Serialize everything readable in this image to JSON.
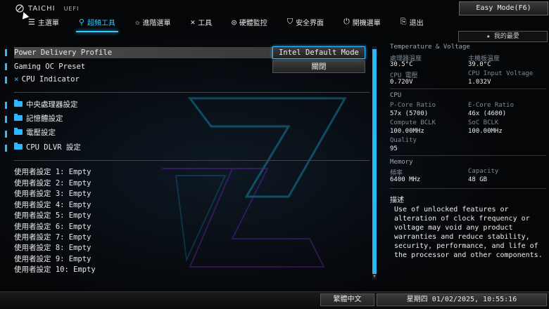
{
  "brand": {
    "name": "TAICHI",
    "sub": "UEFI"
  },
  "easy_mode_label": "Easy Mode(F6)",
  "tabs": [
    {
      "label": "主選單",
      "icon": "list-icon"
    },
    {
      "label": "超頻工具",
      "icon": "rocket-icon"
    },
    {
      "label": "進階選單",
      "icon": "star-icon"
    },
    {
      "label": "工具",
      "icon": "tools-icon"
    },
    {
      "label": "硬體監控",
      "icon": "monitor-icon"
    },
    {
      "label": "安全界面",
      "icon": "shield-icon"
    },
    {
      "label": "開機選單",
      "icon": "power-icon"
    },
    {
      "label": "退出",
      "icon": "exit-icon"
    }
  ],
  "favorites_label": "我的最愛",
  "settings": [
    {
      "label": "Power Delivery Profile",
      "value": "Intel Default Mode"
    },
    {
      "label": "Gaming OC Preset",
      "value": "關閉"
    },
    {
      "label": "CPU Indicator"
    }
  ],
  "folders": [
    "中央處理器設定",
    "記憶體設定",
    "電壓設定",
    "CPU DLVR 設定"
  ],
  "profiles": [
    "使用者設定 1: Empty",
    "使用者設定 2: Empty",
    "使用者設定 3: Empty",
    "使用者設定 4: Empty",
    "使用者設定 5: Empty",
    "使用者設定 6: Empty",
    "使用者設定 7: Empty",
    "使用者設定 8: Empty",
    "使用者設定 9: Empty",
    "使用者設定 10: Empty"
  ],
  "info": {
    "tv_title": "Temperature & Voltage",
    "cpu_temp_label": "處理器溫度",
    "cpu_temp": "30.5°C",
    "mb_temp_label": "主機板溫度",
    "mb_temp": "39.0°C",
    "cpu_volt_label": "CPU 電壓",
    "cpu_volt": "0.720V",
    "cpu_input_label": "CPU Input Voltage",
    "cpu_input": "1.032V",
    "cpu_title": "CPU",
    "pcore_label": "P-Core Ratio",
    "pcore": "57x (5700)",
    "ecore_label": "E-Core Ratio",
    "ecore": "46x (4600)",
    "compute_label": "Compute BCLK",
    "compute": "100.00MHz",
    "soc_label": "SoC BCLK",
    "soc": "100.00MHz",
    "quality_label": "Quality",
    "quality": "95",
    "mem_title": "Memory",
    "freq_label": "頻率",
    "freq": "6400 MHz",
    "cap_label": "Capacity",
    "cap": "48 GB"
  },
  "description": {
    "title": "描述",
    "text": "Use of unlocked features or alteration of clock frequency or voltage may void any product warranties and reduce stability, security, performance, and life of the processor and other components."
  },
  "footer": {
    "language": "繁體中文",
    "datetime": "星期四 01/02/2025, 10:55:16"
  }
}
